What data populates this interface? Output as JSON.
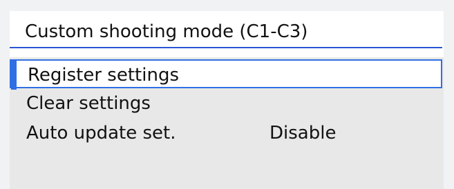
{
  "menu": {
    "title": "Custom shooting mode (C1-C3)",
    "items": [
      {
        "label": "Register settings"
      },
      {
        "label": "Clear settings"
      },
      {
        "label": "Auto update set.",
        "value": "Disable"
      },
      {
        "label": ""
      }
    ],
    "selected_index": 0
  },
  "colors": {
    "accent": "#2f6fe3",
    "title_rule": "#2a55d1",
    "menu_background": "#e8e8e8",
    "selected_background": "#ffffff",
    "page_background": "#f1f2f4"
  }
}
